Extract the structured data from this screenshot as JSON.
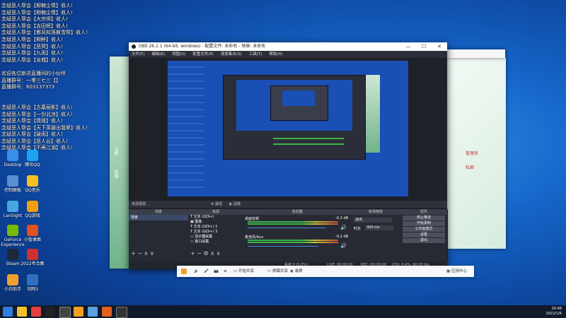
{
  "chat": [
    "念斌恶人帮会【柳楠尘情】收人!",
    "念斌恶人帮会【柳楠尘情】收人!",
    "念斌恶人帮会【大宗师】收人!",
    "念斌恶人帮会【吉田辉】收人!",
    "念斌恶人帮会【都风知落枫雪帮】收人!",
    "念斌恶人帮会【柳醉】收人!",
    "念斌恶人帮会【恶冥】收人!",
    "念斌恶人帮会【九雨】收人!",
    "念斌恶人帮会【龙城】收人!",
    "",
    "欢迎各位新进直播间的小伙伴",
    "直播群号：一零三七三【】",
    "直播群号：603137373",
    "",
    "",
    "念斌恶人帮会【古墓丽影】收人!",
    "念斌恶人帮会【一剑北凉】收人!",
    "念斌恶人帮会【情缘】收人!",
    "念斌恶人帮会【天下英雄出我辈】收人!",
    "念斌恶人帮会【破雨】收人!",
    "念斌恶人帮会【恶人谷】收人!",
    "念斌恶人帮会【不再江湖】收人!"
  ],
  "desktop_icons": [
    {
      "label": "Desktop",
      "color": "#3a8ee8"
    },
    {
      "label": "腾讯QQ",
      "color": "#1aa3f0"
    },
    {
      "label": "控制面板",
      "color": "#5a8fd0"
    },
    {
      "label": "QQ音乐",
      "color": "#f4c020"
    },
    {
      "label": "LanSight",
      "color": "#47a8e0"
    },
    {
      "label": "QQ游戏",
      "color": "#f0a010"
    },
    {
      "label": "GeForce Experience",
      "color": "#76b900"
    },
    {
      "label": "小智桌面",
      "color": "#e05020"
    },
    {
      "label": "Steam",
      "color": "#1b2838"
    },
    {
      "label": "2022年合集",
      "color": "#d03030"
    },
    {
      "label": "小白助手",
      "color": "#f0a030"
    },
    {
      "label": "剑网3",
      "color": "#3070c0"
    }
  ],
  "obs": {
    "title": "OBS 26.1.1 (64-bit, windows) - 配置文件: 未命名 - 场景: 未命名",
    "menu": [
      "文件(F)",
      "编辑(E)",
      "视图(V)",
      "配置文件(P)",
      "场景集合(S)",
      "工具(T)",
      "帮助(H)"
    ],
    "no_source": "未选择源",
    "filter_label": "属性",
    "filter2_label": "滤镜",
    "docks": {
      "scenes": "场景",
      "sources": "来源",
      "mixer": "混音器",
      "transitions": "转场特效",
      "controls": "控件"
    },
    "scene_item": "场景",
    "sources_list": [
      "文本 (GDI+)",
      "图像",
      "文本 (GDI+) 2",
      "文本 (GDI+) 3",
      "显示器采集",
      "窗口采集"
    ],
    "mixer": [
      {
        "name": "桌面音频",
        "db": "-0.2 dB"
      },
      {
        "name": "麦克风/Aux",
        "db": "-0.2 dB"
      }
    ],
    "transition_type": "淡出",
    "duration_label": "时长",
    "duration_value": "300 ms",
    "controls": [
      "停止推流",
      "开始录制",
      "工作室模式",
      "设置",
      "退出"
    ],
    "status": {
      "drop": "丢帧 0 (0.0%)",
      "live": "LIVE: 00:00:00",
      "rec": "REC: 00:00:00",
      "cpu": "CPU: 0.4%, 60.00 fps"
    }
  },
  "taskbar_bottom": {
    "apps": [
      "音频",
      "麦克风",
      "摄像头",
      "屏幕共享",
      "录屏"
    ],
    "share": "开始共享",
    "app_center": "应用中心"
  },
  "tray": {
    "time": "20:48",
    "date": "2022/1/6"
  },
  "bg_window_labels": [
    "注册",
    "充值",
    "管理员",
    "私聊"
  ]
}
